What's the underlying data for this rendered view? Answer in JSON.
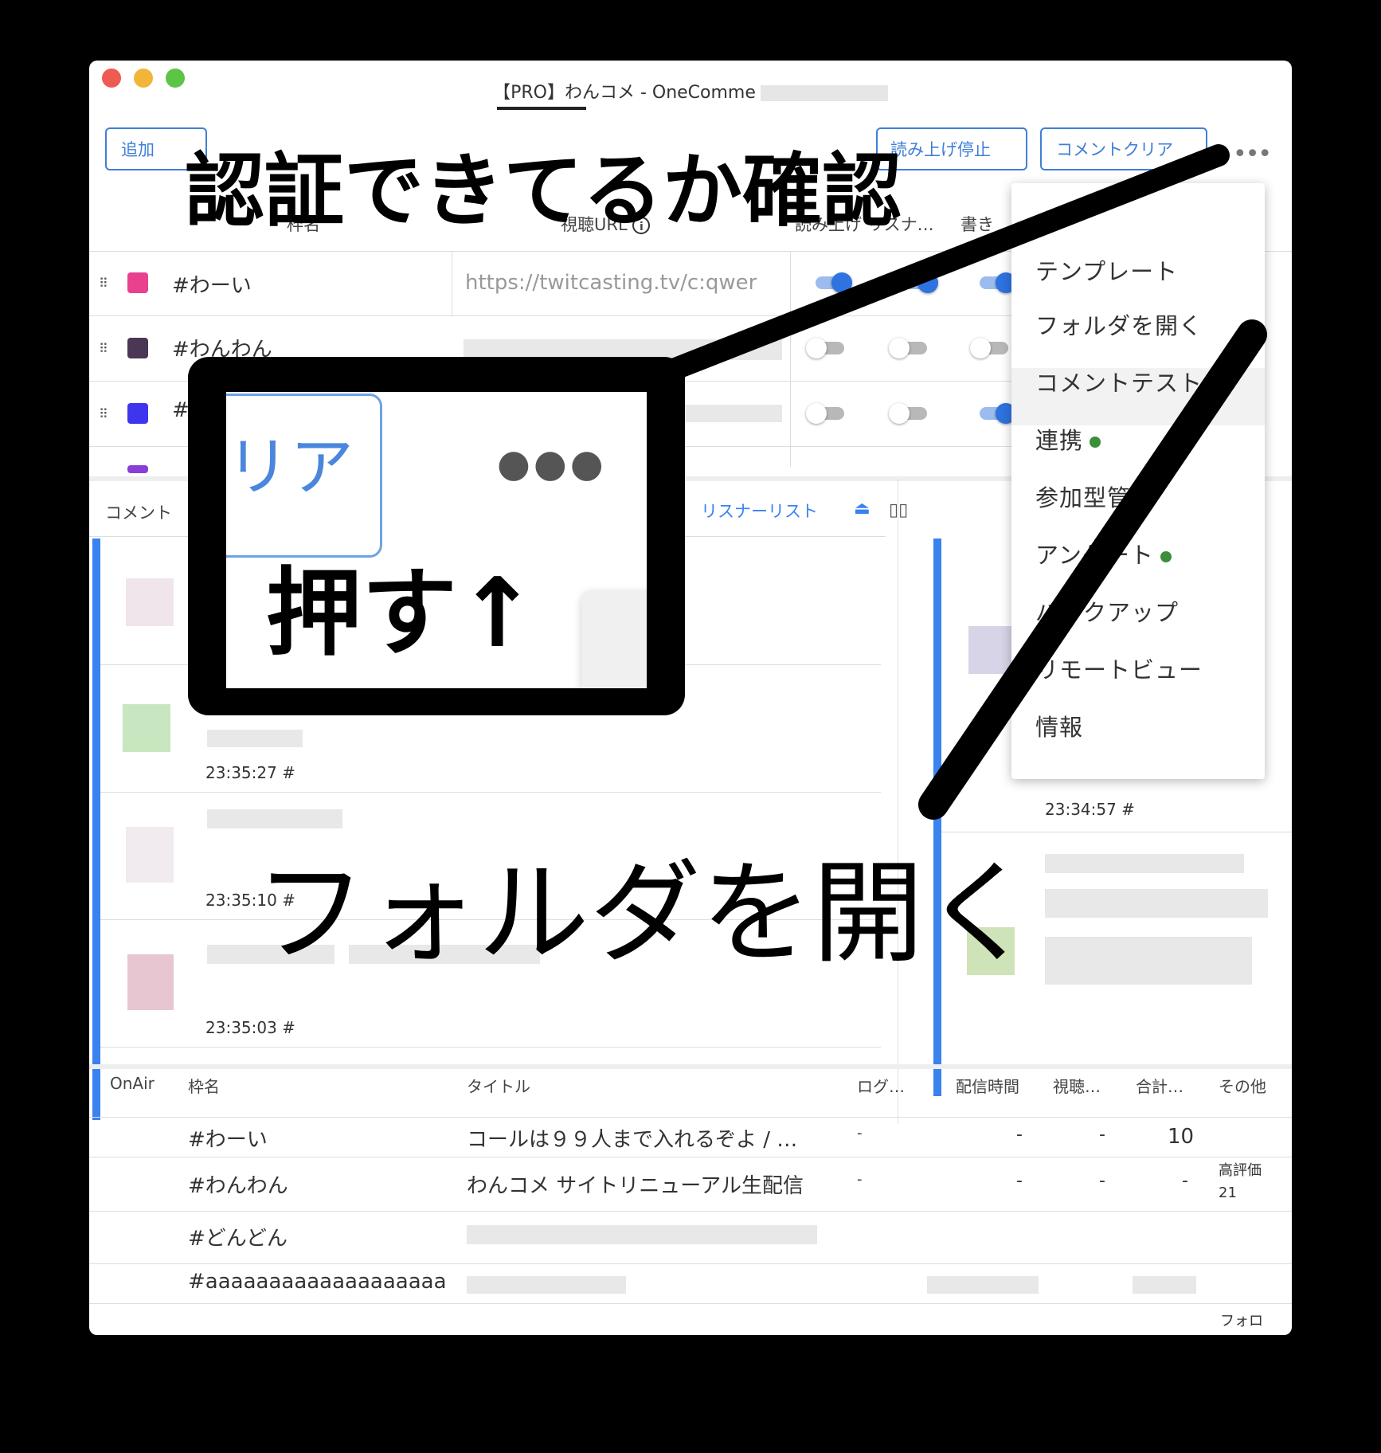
{
  "window": {
    "title": "【PRO】わんコメ - OneComme"
  },
  "toolbar": {
    "add_label": "追加",
    "stop_reading_label": "読み上げ停止",
    "clear_comments_label": "コメントクリア",
    "more_icon": "ellipsis-icon"
  },
  "frames_header": {
    "name": "枠名",
    "url": "視聴URL",
    "read_listener": "読み上げ リスナ…",
    "write": "書き"
  },
  "frames": [
    {
      "name": "#わーい",
      "color": "#e9408f",
      "url": "https://twitcasting.tv/c:qwer"
    },
    {
      "name": "#わんわん",
      "color": "#4a3655"
    },
    {
      "name": "#",
      "color": "#3d36ee"
    }
  ],
  "menu": {
    "items": [
      {
        "label": "テンプレート",
        "dot": false
      },
      {
        "label": "フォルダを開く",
        "dot": false
      },
      {
        "label": "コメントテスト",
        "dot": false
      },
      {
        "label": "連携",
        "dot": true
      },
      {
        "label": "参加型管理",
        "dot": false
      },
      {
        "label": "アンケート",
        "dot": true
      },
      {
        "label": "バックアップ",
        "dot": false
      },
      {
        "label": "リモートビュー",
        "dot": false
      },
      {
        "label": "情報",
        "dot": false
      }
    ],
    "dot_color": "#3a8f3a"
  },
  "comments_panel": {
    "label": "コメント",
    "listener_list": "リスナーリスト",
    "times": [
      "23:35:27 #",
      "23:35:10 #",
      "23:35:03 #"
    ],
    "right_time": "23:34:57 #"
  },
  "table": {
    "headers": [
      "OnAir",
      "枠名",
      "タイトル",
      "ログ…",
      "配信時間",
      "視聴…",
      "合計…",
      "その他"
    ],
    "rows": [
      {
        "name": "#わーい",
        "title": "コールは９９人まで入れるぞよ / …",
        "log": "-",
        "time": "-",
        "view": "-",
        "total": "10",
        "other": ""
      },
      {
        "name": "#わんわん",
        "title": "わんコメ サイトリニューアル生配信",
        "log": "-",
        "time": "-",
        "view": "-",
        "total": "-",
        "other": "高評価 21"
      },
      {
        "name": "#どんどん",
        "title": "",
        "log": "",
        "time": "",
        "view": "",
        "total": "",
        "other": ""
      },
      {
        "name": "#aaaaaaaaaaaaaaaaaaa",
        "title": "",
        "log": "",
        "time": "",
        "view": "",
        "total": "",
        "other": ""
      }
    ],
    "footer_other": "フォロ"
  },
  "annotations": {
    "top": "認証できてるか確認",
    "callout": "押す↑",
    "zoom_text": "リア",
    "bottom": "フォルダを開く"
  },
  "colors": {
    "accent": "#3a82ee",
    "toggle_on": "#2e73e0"
  }
}
